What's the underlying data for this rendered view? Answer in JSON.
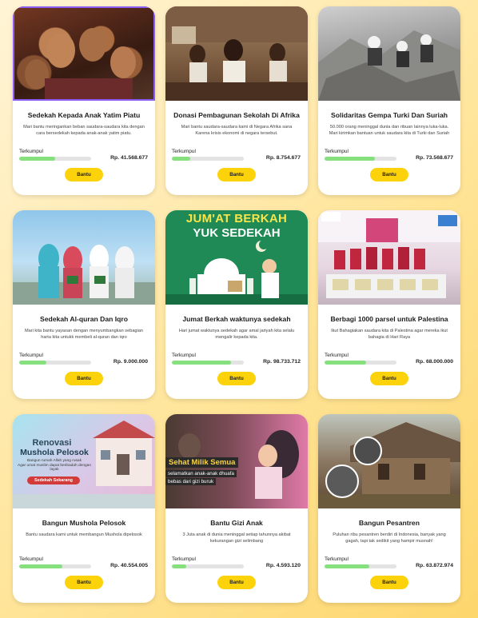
{
  "collected_label": "Terkumpul",
  "button_label": "Bantu",
  "campaigns": [
    {
      "title": "Sedekah Kepada Anak Yatim Piatu",
      "description": "Mari bantu meringankan beban saudara-saudara kita dengan cara bersedekah kepada anak-anak yatim piatu.",
      "amount": "Rp. 41.568.677",
      "progress": 0.5,
      "image": "children-smiling-photo"
    },
    {
      "title": "Donasi Pembagunan Sekolah Di Afrika",
      "description": "Mari bantu saudara-saudara kami di Negara Afrika sana Karena krisis ekonomi di negara tersebut.",
      "amount": "Rp. 8.754.677",
      "progress": 0.25,
      "image": "classroom-africa-photo"
    },
    {
      "title": "Solidaritas Gempa Turki Dan Suriah",
      "description": "50.000 orang meninggal dunia dan ribuan lainnya luka-luka. Mari kirimkan bantuan untuk saudara kita di Turki dan Suriah",
      "amount": "Rp. 73.568.677",
      "progress": 0.7,
      "image": "earthquake-rescue-photo"
    },
    {
      "title": "Sedekah Al-quran Dan Iqro",
      "description": "Mari kita bantu yayasan dengan menyumbangkan sebagian harta kita untukk membeli al-quran dan iqro",
      "amount": "Rp. 9.000.000",
      "progress": 0.38,
      "image": "girls-holding-quran-photo"
    },
    {
      "title": "Jumat Berkah waktunya sedekah",
      "description": "Hari jumat waktunya sedekah agar amal jariyah kita selalu mengalir kepada kita.",
      "amount": "Rp. 98.733.712",
      "progress": 0.82,
      "image": "jumat-berkah-poster",
      "overlay": [
        "JUM'AT BERKAH",
        "YUK SEDEKAH"
      ]
    },
    {
      "title": "Berbagi 1000 parsel untuk Palestina",
      "description": "Ikut Bahagiakan saudara kita di Palestina agar mereka ikut bahagia di Hari Raya",
      "amount": "Rp. 68.000.000",
      "progress": 0.58,
      "image": "parcel-distribution-photo"
    },
    {
      "title": "Bangun Mushola Pelosok",
      "description": "Bantu saudara kami untuk membangun Mushola dipelosok",
      "amount": "Rp. 40.554.005",
      "progress": 0.6,
      "image": "mushola-poster",
      "overlay": [
        "Renovasi",
        "Mushola Pelosok",
        "Bangun rumah Allah yang rusak",
        "Agar umat muslim dapat beribadah dengan layak",
        "Sedekah Sekarang"
      ]
    },
    {
      "title": "Bantu Gizi Anak",
      "description": "3 Juta anak di dunia meninggal setiap tahunnya akibat kekurangan gizi selimbang",
      "amount": "Rp. 4.593.120",
      "progress": 0.2,
      "image": "child-nutrition-poster",
      "overlay": [
        "Sehat Milik Semua",
        "selamatkan anak-anak dhuafa",
        "bebas dari gizi buruk"
      ]
    },
    {
      "title": "Bangun Pesantren",
      "description": "Puluhan ribu pesantren berdiri di Indonesia, banyak yang gagah, tapi tak sedikit yang hampir musnah!",
      "amount": "Rp. 63.872.974",
      "progress": 0.62,
      "image": "old-pesantren-photo"
    }
  ]
}
